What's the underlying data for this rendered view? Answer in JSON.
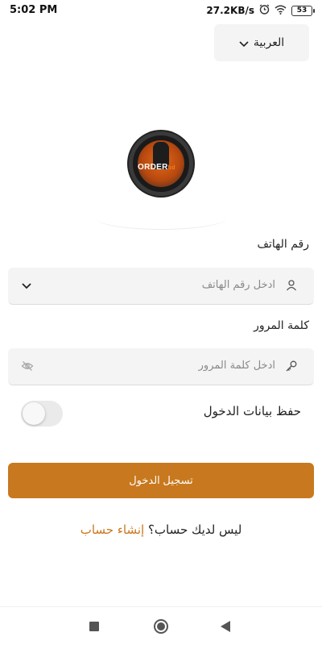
{
  "status_bar": {
    "time": "5:02 PM",
    "network_speed": "27.2KB/s",
    "battery": "53",
    "icons": [
      "alarm-icon",
      "wifi-icon",
      "battery-icon"
    ]
  },
  "language": {
    "selected": "العربية",
    "icon": "chevron-down-icon"
  },
  "logo": {
    "text_main": "ORDER",
    "text_accent": "bd"
  },
  "phone": {
    "label": "رقم الهاتف",
    "placeholder": "ادخل رقم الهاتف",
    "icon": "user-icon",
    "dropdown_icon": "chevron-down-icon"
  },
  "password": {
    "label": "كلمة المرور",
    "placeholder": "ادخل كلمة المرور",
    "icon": "key-icon",
    "visibility_icon": "eye-off-icon"
  },
  "remember": {
    "label": "حفظ بيانات الدخول",
    "enabled": false
  },
  "login": {
    "label": "تسجيل الدخول"
  },
  "signup": {
    "question": "ليس لديك حساب؟",
    "link": "إنشاء حساب"
  },
  "colors": {
    "accent": "#c8781e",
    "field_bg": "#f4f4f4",
    "placeholder": "#8a8a8a"
  }
}
